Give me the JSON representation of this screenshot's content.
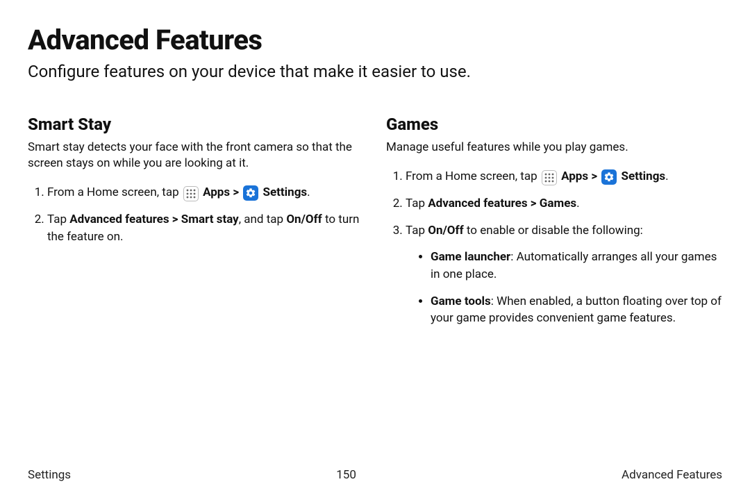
{
  "title": "Advanced Features",
  "subtitle": "Configure features on your device that make it easier to use.",
  "smartStay": {
    "heading": "Smart Stay",
    "desc": "Smart stay detects your face with the front camera so that the screen stays on while you are looking at it.",
    "step1_pre": "From a Home screen, tap ",
    "apps_label": "Apps",
    "sep": " > ",
    "settings_label": "Settings",
    "period": ".",
    "step2_pre": "Tap ",
    "step2_bold": "Advanced features > Smart stay",
    "step2_mid": ", and tap ",
    "step2_onoff": "On/Off",
    "step2_post": " to turn the feature on."
  },
  "games": {
    "heading": "Games",
    "desc": "Manage useful features while you play games.",
    "step1_pre": "From a Home screen, tap ",
    "apps_label": "Apps",
    "sep": " > ",
    "settings_label": "Settings",
    "period": ".",
    "step2_pre": "Tap ",
    "step2_bold": "Advanced features > Games",
    "step2_period": ".",
    "step3_pre": "Tap ",
    "step3_onoff": "On/Off",
    "step3_post": " to enable or disable the following:",
    "bullet1_bold": "Game launcher",
    "bullet1_rest": ": Automatically arranges all your games in one place.",
    "bullet2_bold": "Game tools",
    "bullet2_rest": ": When enabled, a button floating over top of your game provides convenient game features."
  },
  "footer": {
    "left": "Settings",
    "center": "150",
    "right": "Advanced Features"
  }
}
